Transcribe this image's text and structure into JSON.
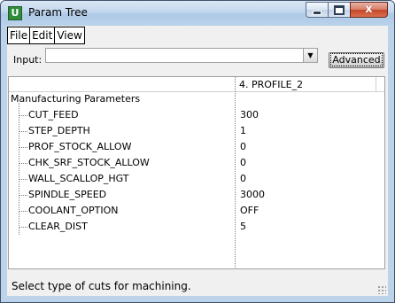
{
  "window": {
    "title": "Param Tree",
    "icon": "app-icon",
    "icon_glyph": "U",
    "close_glyph": "x"
  },
  "menu": [
    "File",
    "Edit",
    "View"
  ],
  "input": {
    "label": "Input:",
    "value": "",
    "dropdown_glyph": "▼"
  },
  "advanced_button": "Advanced",
  "tree": {
    "column_header": "4. PROFILE_2",
    "root_label": "Manufacturing Parameters",
    "params": [
      {
        "name": "CUT_FEED",
        "value": "300"
      },
      {
        "name": "STEP_DEPTH",
        "value": "1"
      },
      {
        "name": "PROF_STOCK_ALLOW",
        "value": "0"
      },
      {
        "name": "CHK_SRF_STOCK_ALLOW",
        "value": "0"
      },
      {
        "name": "WALL_SCALLOP_HGT",
        "value": "0"
      },
      {
        "name": "SPINDLE_SPEED",
        "value": "3000"
      },
      {
        "name": "COOLANT_OPTION",
        "value": "OFF"
      },
      {
        "name": "CLEAR_DIST",
        "value": "5"
      }
    ]
  },
  "status": "Select type of cuts for machining.",
  "colors": {
    "title_bar": "#bcd3ea",
    "close_button": "#c4462a",
    "client_bg": "#f0f0f0"
  }
}
